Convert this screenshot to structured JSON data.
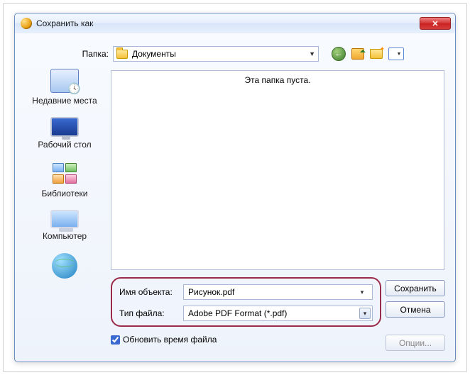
{
  "window": {
    "title": "Сохранить как"
  },
  "folder": {
    "label": "Папка:",
    "value": "Документы"
  },
  "sidebar": [
    {
      "label": "Недавние места"
    },
    {
      "label": "Рабочий стол"
    },
    {
      "label": "Библиотеки"
    },
    {
      "label": "Компьютер"
    },
    {
      "label": ""
    }
  ],
  "list": {
    "empty_text": "Эта папка пуста."
  },
  "form": {
    "name_label": "Имя объекта:",
    "name_value": "Рисунок.pdf",
    "type_label": "Тип файла:",
    "type_value": "Adobe PDF Format (*.pdf)"
  },
  "buttons": {
    "save": "Сохранить",
    "cancel": "Отмена",
    "options": "Опции..."
  },
  "checkbox": {
    "label": "Обновить время файла",
    "checked": true
  }
}
